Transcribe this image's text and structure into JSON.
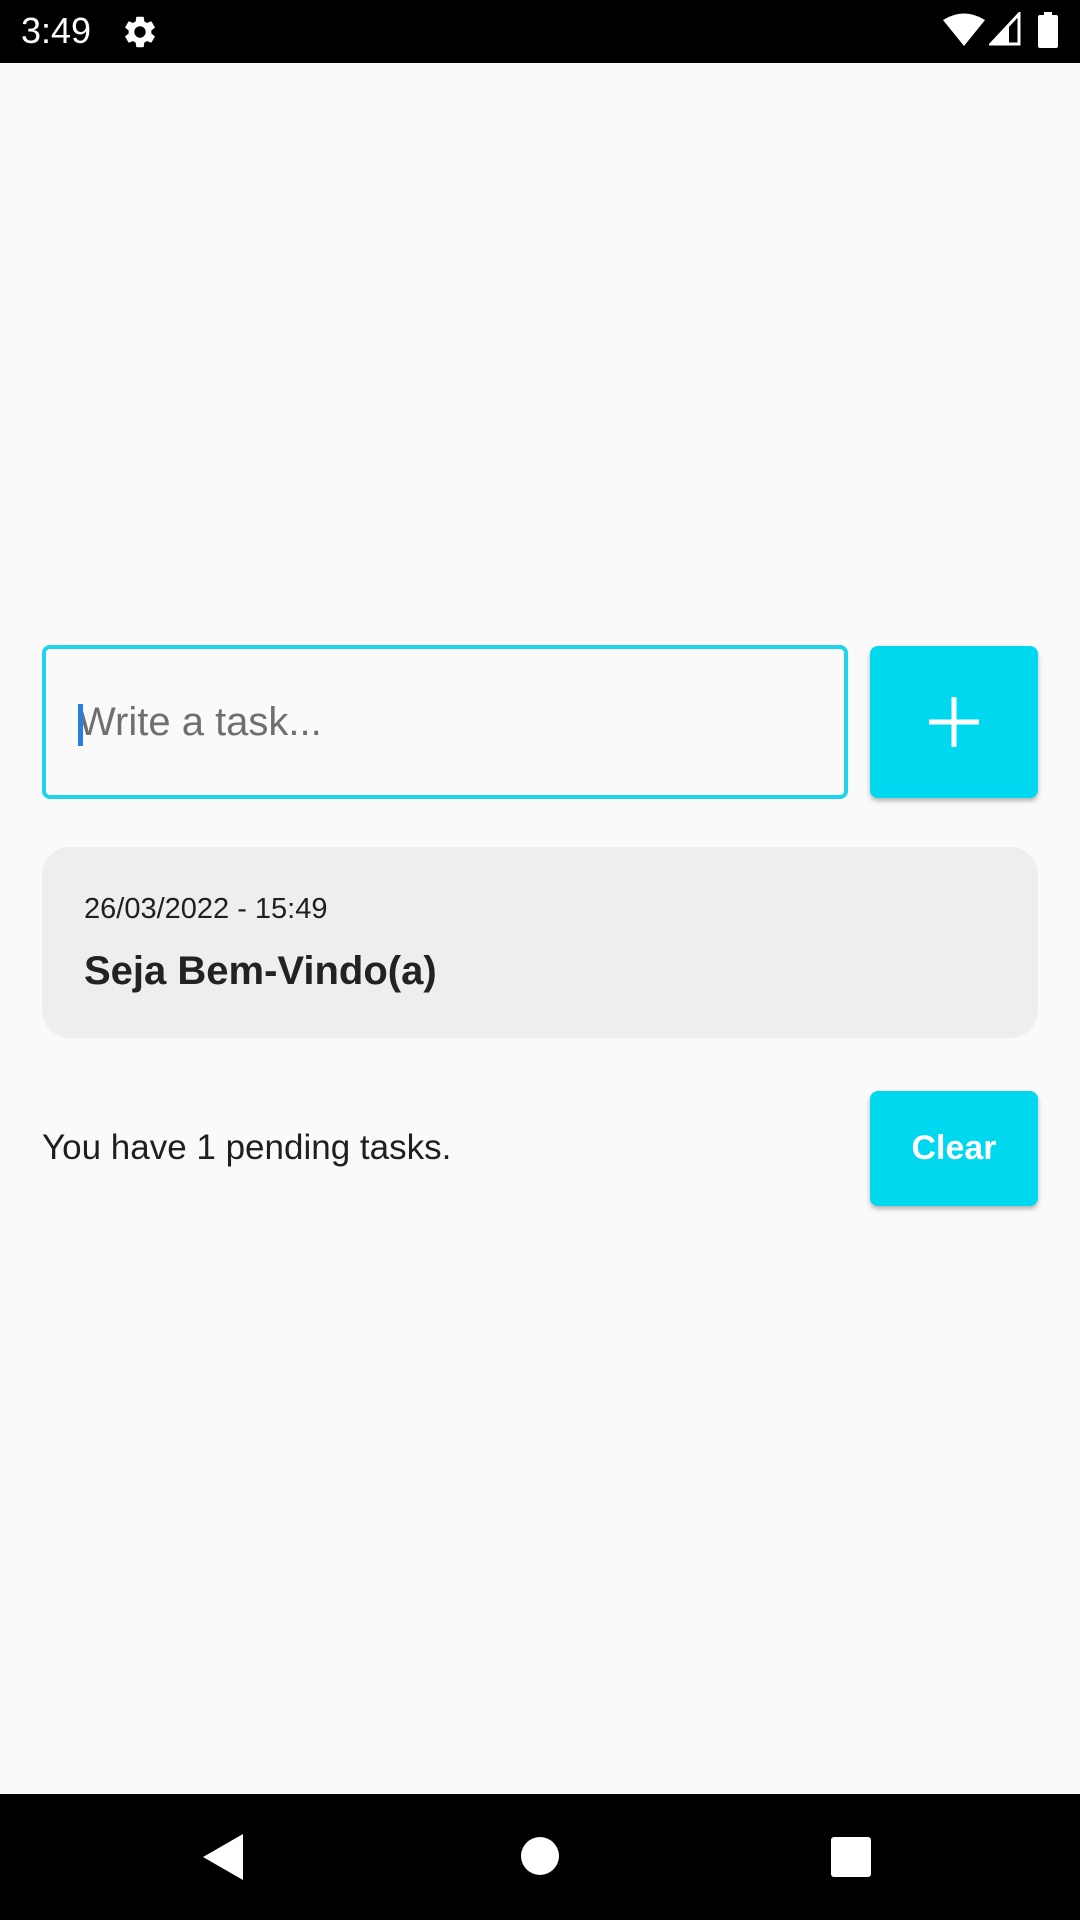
{
  "status_bar": {
    "time": "3:49",
    "icons": [
      "gear-icon",
      "wifi-icon",
      "cell-signal-icon",
      "battery-icon"
    ]
  },
  "task_form": {
    "placeholder": "Write a task...",
    "value": "",
    "add_button_icon": "plus-icon"
  },
  "tasks": [
    {
      "date": "26/03/2022 - 15:49",
      "title": "Seja Bem-Vindo(a)"
    }
  ],
  "footer": {
    "pending_text": "You have 1 pending tasks.",
    "clear_label": "Clear"
  },
  "nav_bar": {
    "icons": [
      "back-icon",
      "home-icon",
      "recents-icon"
    ]
  },
  "colors": {
    "accent": "#00d8f0",
    "input_border": "#1fd3ea",
    "card_background": "#eeeeee",
    "page_background": "#fafafa",
    "caret": "#2a7de1"
  }
}
